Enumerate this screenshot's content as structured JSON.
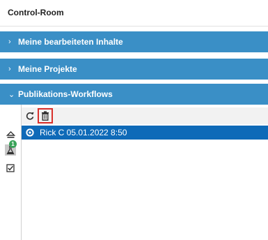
{
  "header": {
    "title": "Control-Room"
  },
  "sections": [
    {
      "label": "Meine bearbeiteten Inhalte",
      "chevron": "›"
    },
    {
      "label": "Meine Projekte",
      "chevron": "›"
    },
    {
      "label": "Publikations-Workflows",
      "chevron": "⌄"
    }
  ],
  "toolbar": {
    "refresh_icon": "refresh-icon",
    "delete_icon": "trash-icon"
  },
  "workflow_rows": [
    {
      "text": "Rick C 05.01.2022 8:50",
      "icon": "workflow-status-icon"
    }
  ],
  "rail": {
    "badge_count": "1"
  },
  "colors": {
    "section_bg": "#3a8fc6",
    "selected_row": "#0e6ab8",
    "highlight_border": "#d9302b",
    "badge": "#3aa35a"
  }
}
